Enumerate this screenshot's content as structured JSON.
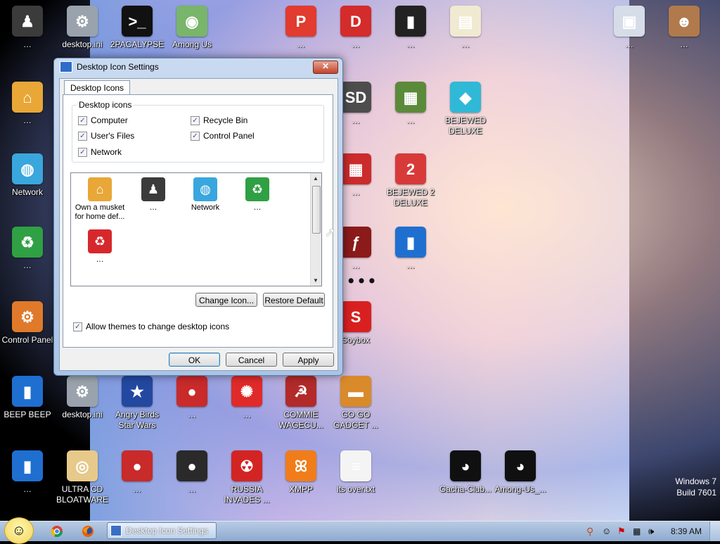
{
  "os": {
    "line1": "Windows 7",
    "line2": "Build 7601"
  },
  "wallpaper_text": "…",
  "desktop_icons": [
    {
      "name": "person-icon",
      "label": "…",
      "color": "#3b3b3b",
      "glyph": "♟"
    },
    {
      "name": "desktop-ini-icon",
      "label": "desktop.ini",
      "color": "#9aa3ad",
      "glyph": "⚙"
    },
    {
      "name": "terminal-icon",
      "label": "2PACALYPSE",
      "color": "#111111",
      "glyph": ">_"
    },
    {
      "name": "among-us-icon",
      "label": "Among Us",
      "color": "#79b56a",
      "glyph": "◉"
    },
    {
      "name": "app-icon",
      "label": "…",
      "color": "#e23b2f",
      "glyph": "P"
    },
    {
      "name": "dev-cpp-icon",
      "label": "…",
      "color": "#d42b2b",
      "glyph": "D"
    },
    {
      "name": "folder-icon",
      "label": "…",
      "color": "#222222",
      "glyph": "▮"
    },
    {
      "name": "certificate-icon",
      "label": "…",
      "color": "#f0ead2",
      "glyph": "▤"
    },
    {
      "name": "image-icon",
      "label": "…",
      "color": "#d6dde8",
      "glyph": "▣"
    },
    {
      "name": "image-icon",
      "label": "…",
      "color": "#b07a4c",
      "glyph": "☻"
    },
    {
      "name": "computer-icon",
      "label": "…",
      "color": "#e8a737",
      "glyph": "⌂"
    },
    {
      "name": "sd-icon",
      "label": "…",
      "color": "#4d4d4d",
      "glyph": "SD"
    },
    {
      "name": "minecraft-icon",
      "label": "…",
      "color": "#5b8a3a",
      "glyph": "▦"
    },
    {
      "name": "bejeweled-icon",
      "label": "BEJEWED DELUXE",
      "color": "#2fb9d6",
      "glyph": "◆"
    },
    {
      "name": "network-icon",
      "label": "Network",
      "color": "#3aa6de",
      "glyph": "◍"
    },
    {
      "name": "minecraft-icon",
      "label": "…",
      "color": "#cc2b2b",
      "glyph": "▦"
    },
    {
      "name": "bejeweled-2-icon",
      "label": "BEJEWED 2 DELUXE",
      "color": "#d83a3a",
      "glyph": "2"
    },
    {
      "name": "recycle-bin-icon",
      "label": "…",
      "color": "#2fa043",
      "glyph": "♻"
    },
    {
      "name": "flash-player-icon",
      "label": "…",
      "color": "#8b1a1a",
      "glyph": "ƒ"
    },
    {
      "name": "app-icon",
      "label": "…",
      "color": "#1f6fd1",
      "glyph": "▮"
    },
    {
      "name": "control-panel-icon",
      "label": "Control Panel",
      "color": "#e07a2a",
      "glyph": "⚙"
    },
    {
      "name": "soybox-icon",
      "label": "Soybox",
      "color": "#d92020",
      "glyph": "S"
    },
    {
      "name": "app-icon",
      "label": "BEEP BEEP",
      "color": "#1f6fd1",
      "glyph": "▮"
    },
    {
      "name": "desktop-ini-icon",
      "label": "desktop.ini",
      "color": "#9aa3ad",
      "glyph": "⚙"
    },
    {
      "name": "angry-birds-icon",
      "label": "Angry Birds Star Wars",
      "color": "#2348a0",
      "glyph": "★"
    },
    {
      "name": "angry-birds-icon",
      "label": "…",
      "color": "#c92a2a",
      "glyph": "●"
    },
    {
      "name": "chuzzle-icon",
      "label": "…",
      "color": "#e02a2a",
      "glyph": "✺"
    },
    {
      "name": "app-icon",
      "label": "COMMIE WAGECU...",
      "color": "#b22a2a",
      "glyph": "☭"
    },
    {
      "name": "briefcase-icon",
      "label": "GO GO GADGET ...",
      "color": "#d98a2a",
      "glyph": "▬"
    },
    {
      "name": "app-icon",
      "label": "…",
      "color": "#1f6fd1",
      "glyph": "▮"
    },
    {
      "name": "disc-icon",
      "label": "ULTRA CD BLOATWARE",
      "color": "#e7c98a",
      "glyph": "◎"
    },
    {
      "name": "angry-birds-icon",
      "label": "…",
      "color": "#c92a2a",
      "glyph": "●"
    },
    {
      "name": "angry-birds-icon",
      "label": "…",
      "color": "#2a2a2a",
      "glyph": "●"
    },
    {
      "name": "radiation-icon",
      "label": "RUSSIA INVADES ...",
      "color": "#d32424",
      "glyph": "☢"
    },
    {
      "name": "xampp-icon",
      "label": "XMPP",
      "color": "#f07d1a",
      "glyph": "ꕤ"
    },
    {
      "name": "text-file-icon",
      "label": "its over.txt",
      "color": "#f4f4f4",
      "glyph": "≡"
    },
    {
      "name": "gacha-icon",
      "label": "Gacha-Club...",
      "color": "#101010",
      "glyph": "◕"
    },
    {
      "name": "among-us-icon",
      "label": "Among-Us_...",
      "color": "#101010",
      "glyph": "◕"
    }
  ],
  "dialog": {
    "title": "Desktop Icon Settings",
    "close": "✕",
    "tab": "Desktop Icons",
    "group_title": "Desktop icons",
    "checkboxes": [
      {
        "label": "Computer",
        "checked": true
      },
      {
        "label": "Recycle Bin",
        "checked": true
      },
      {
        "label": "User's Files",
        "checked": true
      },
      {
        "label": "Control Panel",
        "checked": true
      },
      {
        "label": "Network",
        "checked": true
      }
    ],
    "icon_list": [
      {
        "name": "computer-icon",
        "label": "Own a musket for home def...",
        "color": "#e8a737",
        "glyph": "⌂"
      },
      {
        "name": "person-icon",
        "label": "…",
        "color": "#3b3b3b",
        "glyph": "♟"
      },
      {
        "name": "network-icon",
        "label": "Network",
        "color": "#3aa6de",
        "glyph": "◍"
      },
      {
        "name": "recycle-bin-icon",
        "label": "…",
        "color": "#2fa043",
        "glyph": "♻"
      },
      {
        "name": "recycle-bin-full-icon",
        "label": "…",
        "color": "#d6282c",
        "glyph": "♻"
      }
    ],
    "change_icon": "Change Icon...",
    "restore_default": "Restore Default",
    "allow_themes": "Allow themes to change desktop icons",
    "allow_themes_checked": true,
    "ok": "OK",
    "cancel": "Cancel",
    "apply": "Apply"
  },
  "taskbar": {
    "active_task": "Desktop Icon Settings",
    "clock": "8:39 AM"
  }
}
